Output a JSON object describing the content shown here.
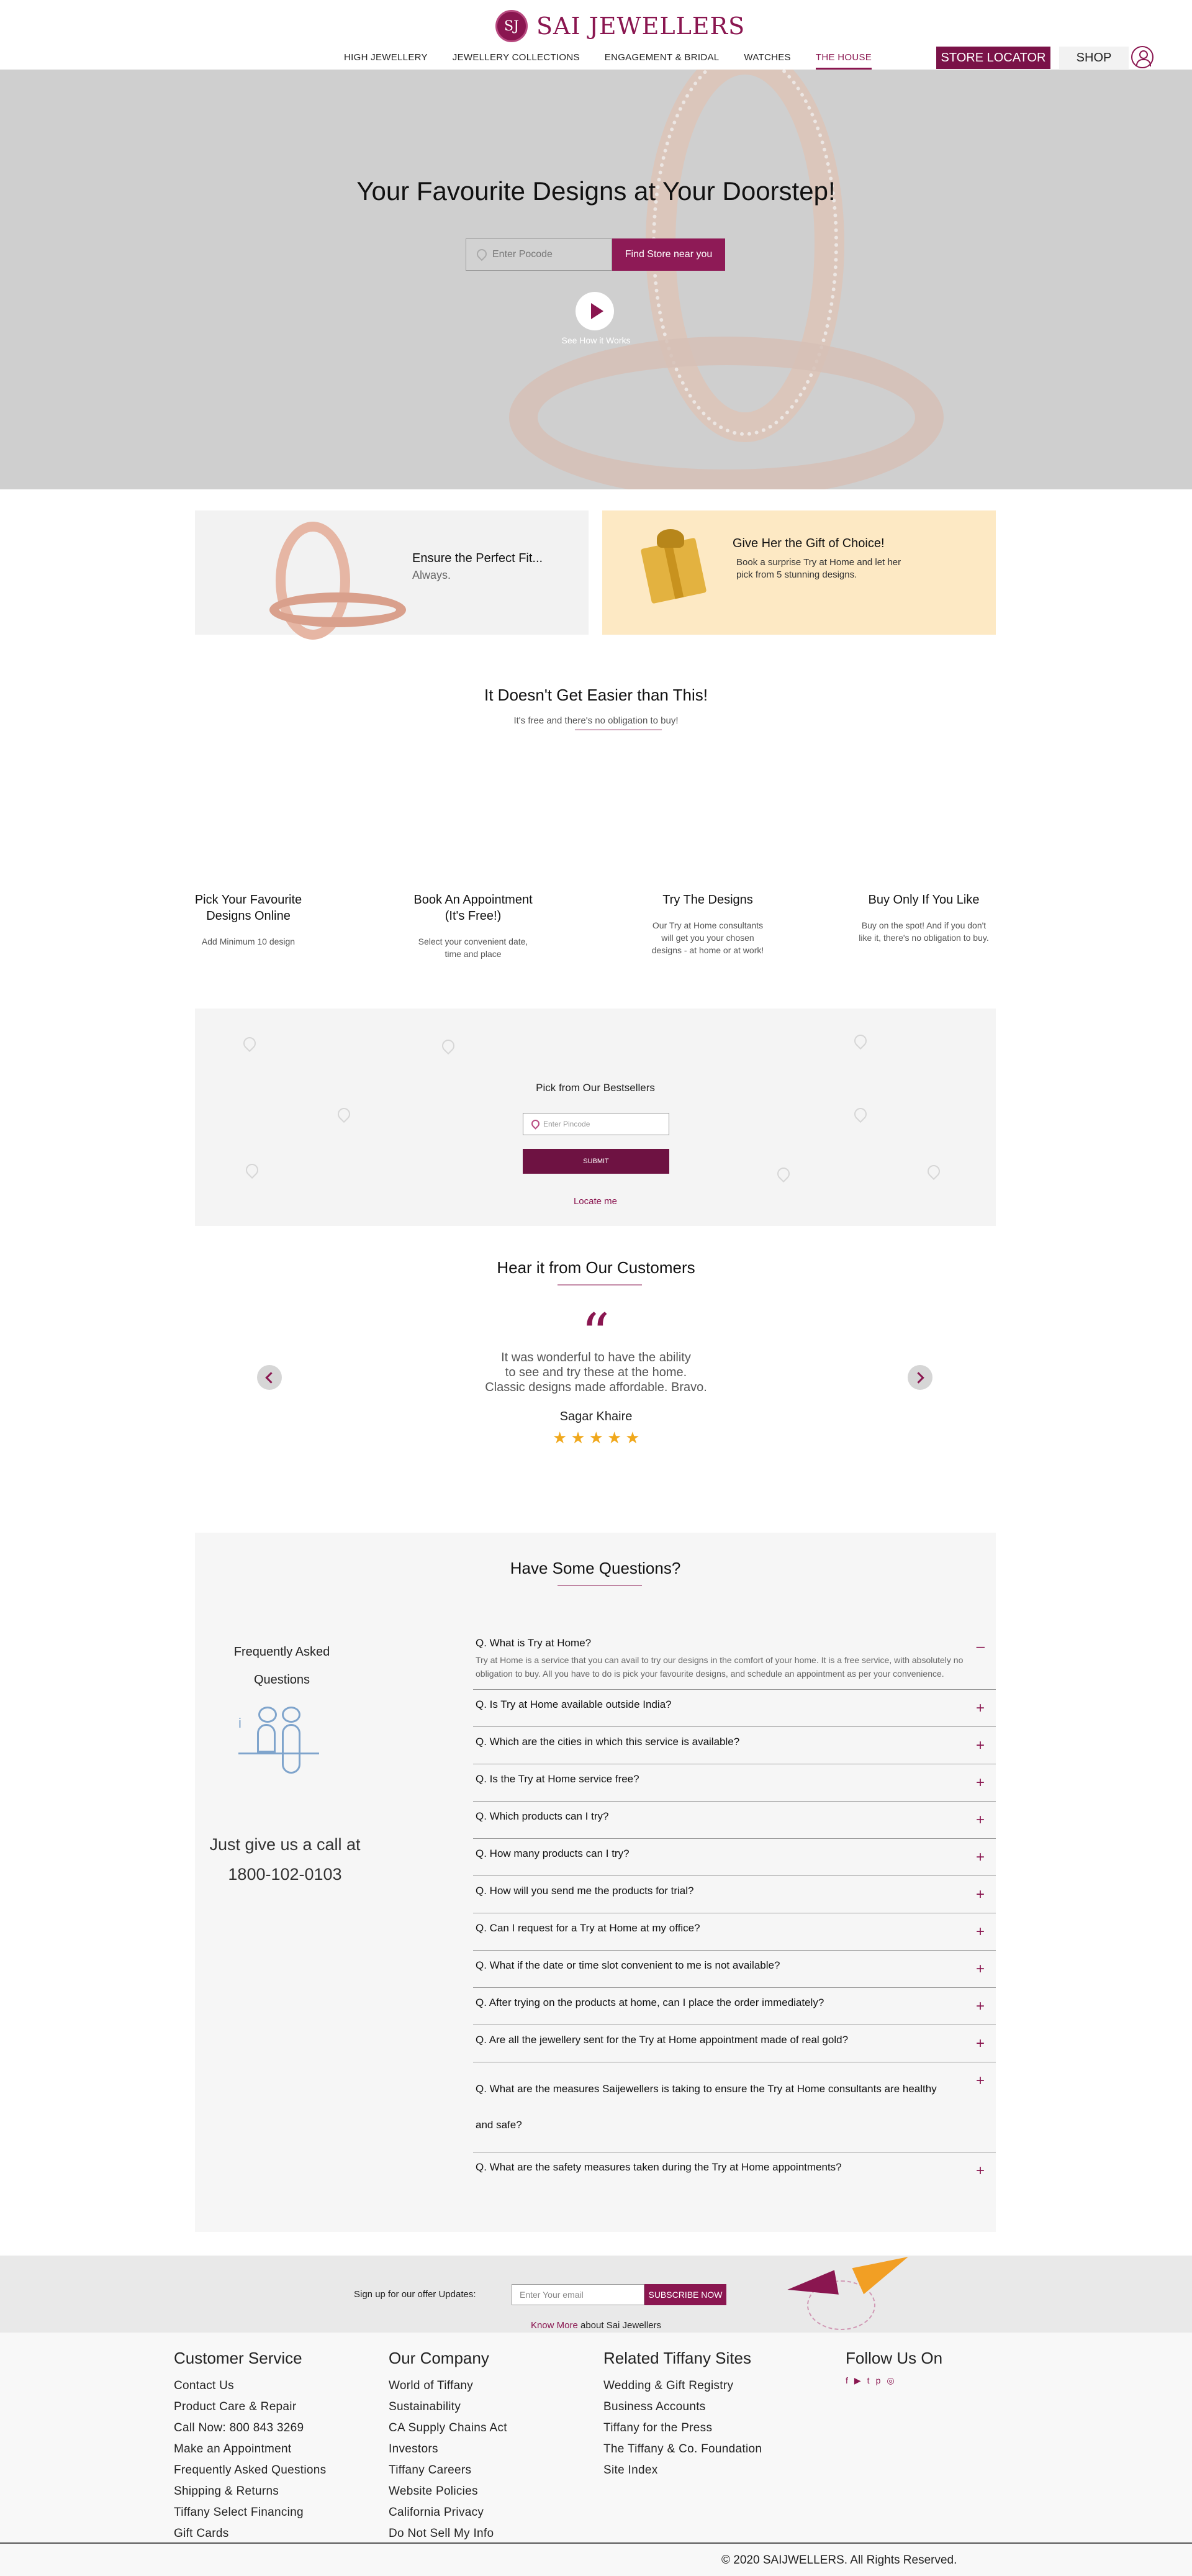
{
  "brand": {
    "logo_mark": "SJ",
    "name": "SAI JEWELLERS",
    "accent_color": "#8a1650"
  },
  "nav": {
    "items": [
      {
        "label": "HIGH JEWELLERY"
      },
      {
        "label": "JEWELLERY COLLECTIONS"
      },
      {
        "label": "ENGAGEMENT & BRIDAL"
      },
      {
        "label": "WATCHES"
      },
      {
        "label": "THE HOUSE",
        "active": true
      }
    ],
    "store_locator": "STORE LOCATOR",
    "shop": "SHOP",
    "user_icon": "user-icon"
  },
  "hero": {
    "title": "Your Favourite Designs at Your Doorstep!",
    "pincode_placeholder": "Enter Pocode",
    "find_button": "Find Store near you",
    "caption": "See How it Works"
  },
  "promos": {
    "left": {
      "title": "Ensure the Perfect Fit...",
      "subtitle": "Always."
    },
    "right": {
      "title": "Give Her the Gift of Choice!",
      "text_line1": "Book a surprise Try at Home and let her",
      "text_line2": "pick from 5 stunning designs."
    }
  },
  "steps_section": {
    "title": "It Doesn't Get Easier than This!",
    "subtitle": "It's free and there's no obligation to buy!",
    "steps": [
      {
        "title_line1": "Pick Your Favourite",
        "title_line2": "Designs Online",
        "desc_line1": "Add Minimum 10 design",
        "desc_line2": "",
        "desc_line3": ""
      },
      {
        "title_line1": "Book An Appointment",
        "title_line2": "(It's Free!)",
        "desc_line1": "Select your convenient date,",
        "desc_line2": "time and place",
        "desc_line3": ""
      },
      {
        "title_line1": "Try The Designs",
        "title_line2": "",
        "desc_line1": "Our Try at Home consultants",
        "desc_line2": "will get you your chosen",
        "desc_line3": "designs - at home or at work!"
      },
      {
        "title_line1": "Buy Only If You Like",
        "title_line2": "",
        "desc_line1": "Buy on the spot! And if you don't",
        "desc_line2": "like it, there's no obligation to buy.",
        "desc_line3": ""
      }
    ]
  },
  "bestsellers": {
    "title": "Pick from Our Bestsellers",
    "pincode_placeholder": "Enter Pincode",
    "submit": "SUBMIT",
    "locate": "Locate me"
  },
  "testimonials": {
    "title": "Hear it from Our Customers",
    "quote_line1": "It was wonderful to have the ability",
    "quote_line2": "to see and try these at the home.",
    "quote_line3": "Classic designs made affordable. Bravo.",
    "author": "Sagar Khaire",
    "rating": 5
  },
  "faq": {
    "title": "Have Some Questions?",
    "left_title_line1": "Frequently Asked",
    "left_title_line2": "Questions",
    "call_line1": "Just give us a call at",
    "call_line2": "1800-102-0103",
    "items": [
      {
        "q": "Q. What is Try at Home?",
        "a": "Try at Home is a service that you can avail to try our designs in the comfort of your home. It is a free service, with absolutely no obligation to buy. All you have to do is pick your favourite designs, and schedule an appointment as per your convenience.",
        "toggle": "–"
      },
      {
        "q": "Q. Is Try at Home available outside India?",
        "toggle": "+"
      },
      {
        "q": "Q. Which are the cities in which this service is available?",
        "toggle": "+"
      },
      {
        "q": "Q. Is the Try at Home service free?",
        "toggle": "+"
      },
      {
        "q": "Q. Which products can I try?",
        "toggle": "+"
      },
      {
        "q": "Q. How many products can I try?",
        "toggle": "+"
      },
      {
        "q": "Q. How will you send me the products for trial?",
        "toggle": "+"
      },
      {
        "q": "Q. Can I request for a Try at Home at my office?",
        "toggle": "+"
      },
      {
        "q": "Q. What if the date or time slot convenient to me is not available?",
        "toggle": "+"
      },
      {
        "q": "Q. After trying on the products at home, can I place the order immediately?",
        "toggle": "+"
      },
      {
        "q": "Q. Are all the jewellery sent for the Try at Home appointment made of real gold?",
        "toggle": "+"
      },
      {
        "q": "Q. What are the measures Saijewellers is taking to ensure the Try at Home consultants are healthy and safe?",
        "toggle": "+"
      },
      {
        "q": "Q. What are the safety measures taken during the Try at Home appointments?",
        "toggle": "+"
      }
    ]
  },
  "signup": {
    "label": "Sign up for our offer Updates:",
    "email_placeholder": "Enter Your email",
    "button": "SUBSCRIBE NOW",
    "know_more": "Know More",
    "about": "about Sai Jewellers"
  },
  "footer": {
    "columns": [
      {
        "heading": "Customer Service",
        "links": [
          "Contact Us",
          "Product Care & Repair",
          "Call Now: 800 843 3269",
          "Make an Appointment",
          "Frequently Asked Questions",
          "Shipping & Returns",
          "Tiffany Select Financing",
          "Gift Cards"
        ]
      },
      {
        "heading": "Our Company",
        "links": [
          "World of Tiffany",
          "Sustainability",
          "CA Supply Chains Act",
          "Investors",
          "Tiffany Careers",
          "Website Policies",
          "California Privacy",
          "Do Not Sell My Info"
        ]
      },
      {
        "heading": "Related Tiffany Sites",
        "links": [
          "Wedding & Gift Registry",
          "Business Accounts",
          "Tiffany for the Press",
          "The Tiffany & Co. Foundation",
          "Site Index"
        ]
      },
      {
        "heading": "Follow Us On",
        "social_icons": [
          "facebook-icon",
          "youtube-icon",
          "twitter-icon",
          "pinterest-icon",
          "instagram-icon"
        ]
      }
    ],
    "copyright": "© 2020 SAIJWELLERS. All Rights Reserved."
  }
}
